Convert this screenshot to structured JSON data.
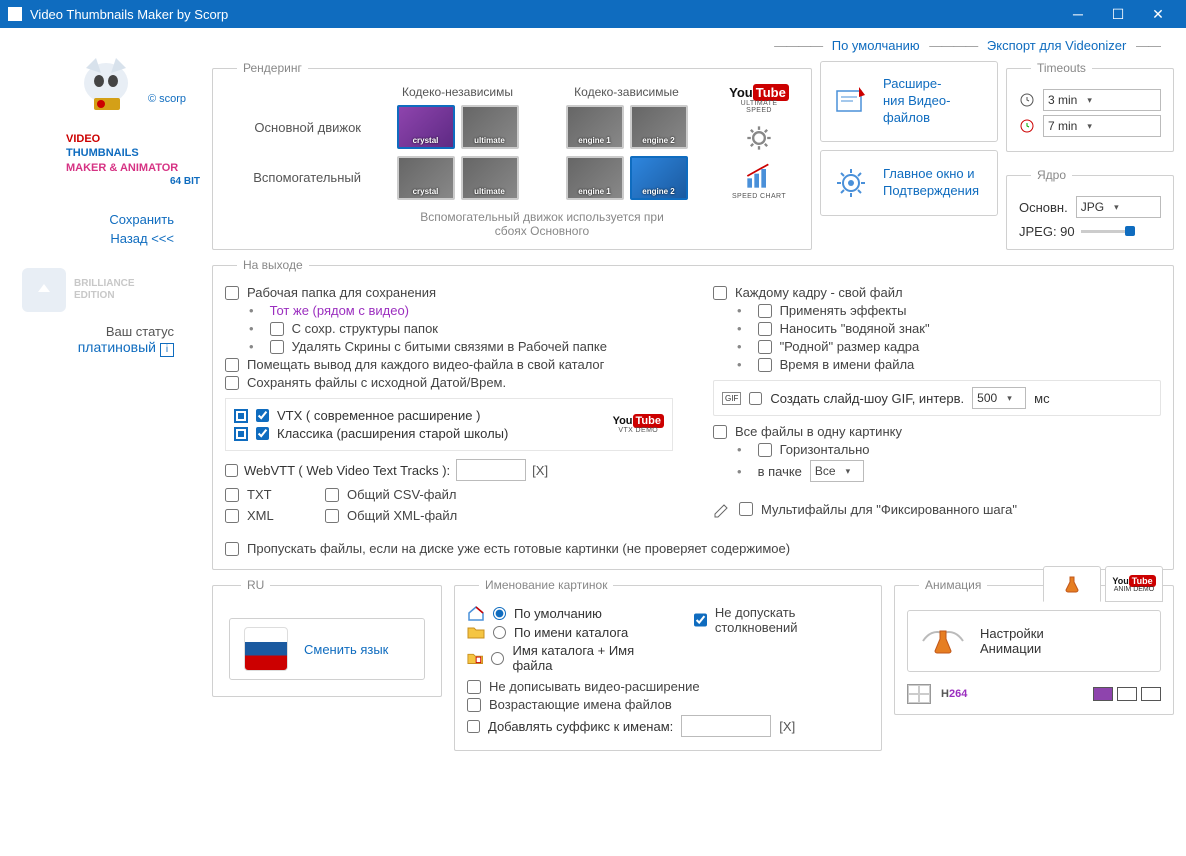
{
  "title": "Video Thumbnails Maker by Scorp",
  "scorp": "© scorp",
  "product": {
    "l1": "VIDEO",
    "l2": "THUMBNAILS",
    "l3": "MAKER & ANIMATOR",
    "l4": "64 BIT"
  },
  "sidebar": {
    "save": "Сохранить",
    "back": "Назад <<<",
    "brilliance": "BRILLIANCE\nEDITION",
    "status_lbl": "Ваш статус",
    "status_val": "платиновый"
  },
  "toplinks": {
    "default": "По умолчанию",
    "export": "Экспорт для Videonizer"
  },
  "render": {
    "legend": "Рендеринг",
    "head_indep": "Кодеко-независимы",
    "head_dep": "Кодеко-зависимые",
    "row_main": "Основной движок",
    "row_aux": "Вспомогательный",
    "eng": {
      "crystal": "crystal",
      "ultimate": "ultimate",
      "e1": "engine 1",
      "e2": "engine 2"
    },
    "foot1": "Вспомогательный движок используется при",
    "foot2": "сбоях Основного",
    "yt_sub": "ULTIMATE\nSPEED",
    "chart_sub": "SPEED CHART"
  },
  "bigbtns": {
    "ext": "Расшире-\nния Видео-\nфайлов",
    "confirm": "Главное окно и\nПодтверждения"
  },
  "timeouts": {
    "legend": "Timeouts",
    "t1": "3 min",
    "t2": "7 min"
  },
  "core": {
    "legend": "Ядро",
    "main_lbl": "Основн.",
    "fmt": "JPG",
    "jpeg": "JPEG: 90"
  },
  "output": {
    "legend": "На выходе",
    "workdir": "Рабочая папка для сохранения",
    "same": "Тот же (рядом с видео)",
    "struct": "С сохр. структуры папок",
    "delbroken": "Удалять Скрины с битыми связями в Рабочей папке",
    "perfile": "Помещать вывод для каждого видео-файла в свой каталог",
    "origdate": "Сохранять файлы с исходной Датой/Врем.",
    "vtx": "VTX ( современное расширение )",
    "classic": "Классика (расширения старой школы)",
    "vtx_demo": "VTX DEMO",
    "webvtt": "WebVTT ( Web Video Text Tracks ):",
    "txt": "TXT",
    "csv": "Общий CSV-файл",
    "xml": "XML",
    "xmlc": "Общий XML-файл",
    "clr": "[X]",
    "skip": "Пропускать файлы, если на диске уже есть готовые картинки (не проверяет содержимое)",
    "eachframe": "Каждому кадру - свой файл",
    "effects": "Применять эффекты",
    "watermark": "Наносить \"водяной знак\"",
    "native": "\"Родной\" размер кадра",
    "timeinname": "Время в имени файла",
    "gif": "Создать слайд-шоу GIF, интерв.",
    "gifval": "500",
    "ms": "мс",
    "allone": "Все файлы в одну картинку",
    "horiz": "Горизонтально",
    "bunch": "в пачке",
    "bunch_val": "Все",
    "multi": "Мультифайлы для \"Фиксированного шага\""
  },
  "ru": {
    "legend": "RU",
    "btn": "Сменить язык"
  },
  "naming": {
    "legend": "Именование картинок",
    "r1": "По умолчанию",
    "r2": "По имени каталога",
    "r3": "Имя каталога + Имя файла",
    "nocollide": "Не допускать столкновений",
    "noext": "Не дописывать видео-расширение",
    "incr": "Возрастающие имена файлов",
    "suffix": "Добавлять суффикс к именам:",
    "clr": "[X]"
  },
  "anim": {
    "legend": "Анимация",
    "tab2": "ANIM DEMO",
    "btn": "Настройки\nАнимации",
    "h264": "H264"
  }
}
